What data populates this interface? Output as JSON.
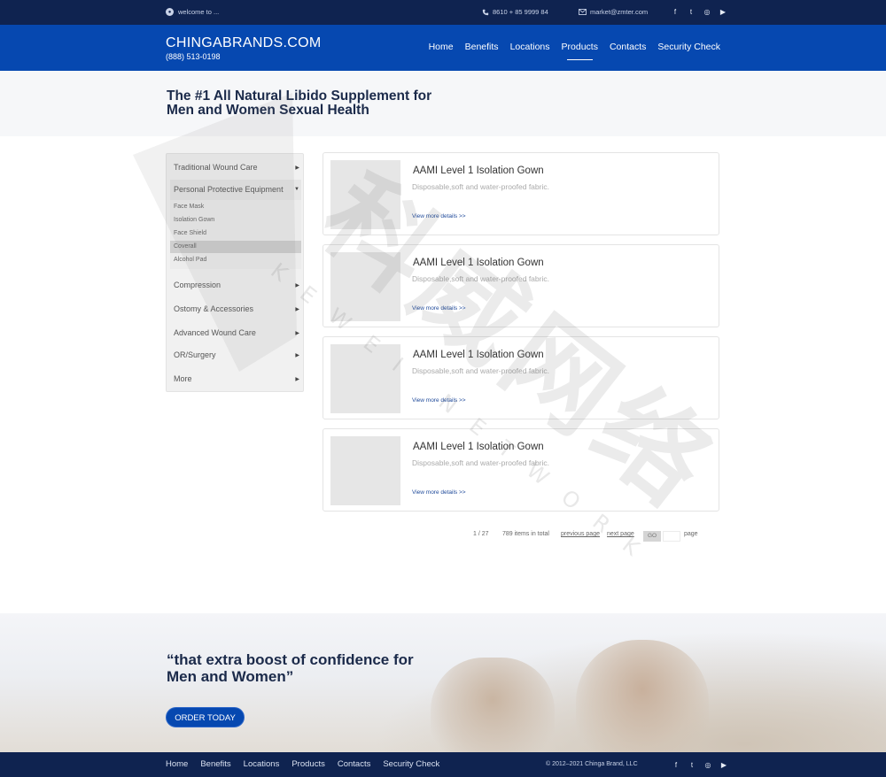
{
  "topbar": {
    "welcome": "welcome to ...",
    "phone": "8610 + 85 9999 84",
    "email": "market@zmter.com",
    "socials": [
      "f",
      "t",
      "◎",
      "▶"
    ]
  },
  "header": {
    "brand": "CHINGABRANDS.COM",
    "tel": "(888) 513-0198",
    "nav": [
      "Home",
      "Benefits",
      "Locations",
      "Products",
      "Contacts",
      "Security Check"
    ],
    "active": "Products"
  },
  "hero": {
    "title_line1": "The #1 All Natural Libido Supplement for",
    "title_line2": "Men and Women Sexual Health"
  },
  "sidebar": {
    "categories": [
      "Traditional Wound Care",
      "Personal Protective Equipment",
      "Compression",
      "Ostomy & Accessories",
      "Advanced Wound Care",
      "OR/Surgery",
      "More"
    ],
    "subitems": [
      "Face Mask",
      "Isolation Gown",
      "Face Shield",
      "Coverall",
      "Alcohol Pad"
    ],
    "selected_sub": "Coverall"
  },
  "products": [
    {
      "title": "AAMI Level 1 Isolation Gown",
      "desc": "Disposable,soft and water-proofed fabric.",
      "more": "View more details >>"
    },
    {
      "title": "AAMI Level 1 Isolation Gown",
      "desc": "Disposable,soft and water-proofed fabric.",
      "more": "View more details >>"
    },
    {
      "title": "AAMI Level 1 Isolation Gown",
      "desc": "Disposable,soft and water-proofed fabric.",
      "more": "View more details >>"
    },
    {
      "title": "AAMI Level 1 Isolation Gown",
      "desc": "Disposable,soft and water-proofed fabric.",
      "more": "View more details >>"
    }
  ],
  "pagination": {
    "current": "1 / 27",
    "total": "789 items in total",
    "prev": "previous page",
    "next": "next page",
    "go": "GO",
    "page": "page"
  },
  "banner": {
    "quote_line1": "“that extra boost of confidence for",
    "quote_line2": "Men and Women”",
    "cta": "ORDER TODAY"
  },
  "footer": {
    "nav": [
      "Home",
      "Benefits",
      "Locations",
      "Products",
      "Contacts",
      "Security Check"
    ],
    "copyright": "© 2012–2021 Chinga Brand, LLC"
  },
  "watermark": {
    "text": "科威网络",
    "subtext": "KEWEI NETWORK"
  },
  "colors": {
    "topbar": "#0f2350",
    "header": "#0648b0",
    "accent": "#1f4a9a"
  }
}
